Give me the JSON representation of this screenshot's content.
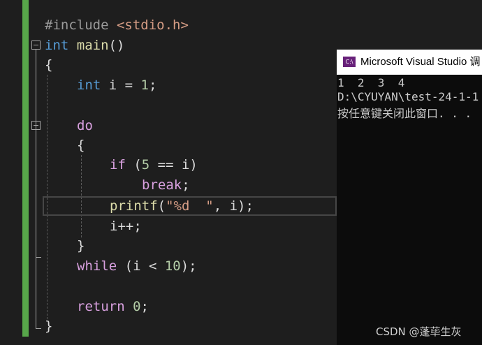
{
  "editor": {
    "lines": [
      {
        "id": "l1",
        "parts": [
          {
            "t": "#include ",
            "c": "pp"
          },
          {
            "t": "<stdio.h>",
            "c": "inc"
          }
        ]
      },
      {
        "id": "l2",
        "parts": [
          {
            "t": "int",
            "c": "kw"
          },
          {
            "t": " "
          },
          {
            "t": "main",
            "c": "fn"
          },
          {
            "t": "()"
          }
        ]
      },
      {
        "id": "l3",
        "parts": [
          {
            "t": "{"
          }
        ]
      },
      {
        "id": "l4",
        "parts": [
          {
            "t": "int",
            "c": "kw"
          },
          {
            "t": " i = "
          },
          {
            "t": "1",
            "c": "num"
          },
          {
            "t": ";"
          }
        ]
      },
      {
        "id": "l5",
        "parts": []
      },
      {
        "id": "l6",
        "parts": [
          {
            "t": "do",
            "c": "ctl"
          }
        ]
      },
      {
        "id": "l7",
        "parts": [
          {
            "t": "{"
          }
        ]
      },
      {
        "id": "l8",
        "parts": [
          {
            "t": "if",
            "c": "ctl"
          },
          {
            "t": " ("
          },
          {
            "t": "5",
            "c": "num"
          },
          {
            "t": " == i)"
          }
        ]
      },
      {
        "id": "l9",
        "parts": [
          {
            "t": "break",
            "c": "ctl"
          },
          {
            "t": ";"
          }
        ]
      },
      {
        "id": "l10",
        "parts": [
          {
            "t": "printf",
            "c": "fn"
          },
          {
            "t": "("
          },
          {
            "t": "\"%d  \"",
            "c": "str"
          },
          {
            "t": ", i);"
          }
        ]
      },
      {
        "id": "l11",
        "parts": [
          {
            "t": "i++;"
          }
        ]
      },
      {
        "id": "l12",
        "parts": [
          {
            "t": "}"
          }
        ]
      },
      {
        "id": "l13",
        "parts": [
          {
            "t": "while",
            "c": "ctl"
          },
          {
            "t": " (i < "
          },
          {
            "t": "10",
            "c": "num"
          },
          {
            "t": ");"
          }
        ]
      },
      {
        "id": "l14",
        "parts": []
      },
      {
        "id": "l15",
        "parts": [
          {
            "t": "return",
            "c": "ctl"
          },
          {
            "t": " "
          },
          {
            "t": "0",
            "c": "num"
          },
          {
            "t": ";"
          }
        ]
      },
      {
        "id": "l16",
        "parts": [
          {
            "t": "}"
          }
        ]
      }
    ]
  },
  "console": {
    "title": "Microsoft Visual Studio 调",
    "icon_text": "C:\\",
    "output": [
      "1  2  3  4",
      "D:\\CYUYAN\\test-24-1-1",
      "按任意键关闭此窗口. . ."
    ]
  },
  "watermark": "CSDN @蓬荜生灰",
  "colors": {
    "background": "#1e1e1e",
    "keyword": "#569cd6",
    "control": "#d8a0df",
    "function": "#dcdcaa",
    "number": "#b5cea8",
    "string": "#d69d85",
    "change_bar": "#57a64a",
    "console_bg": "#0c0c0c"
  }
}
